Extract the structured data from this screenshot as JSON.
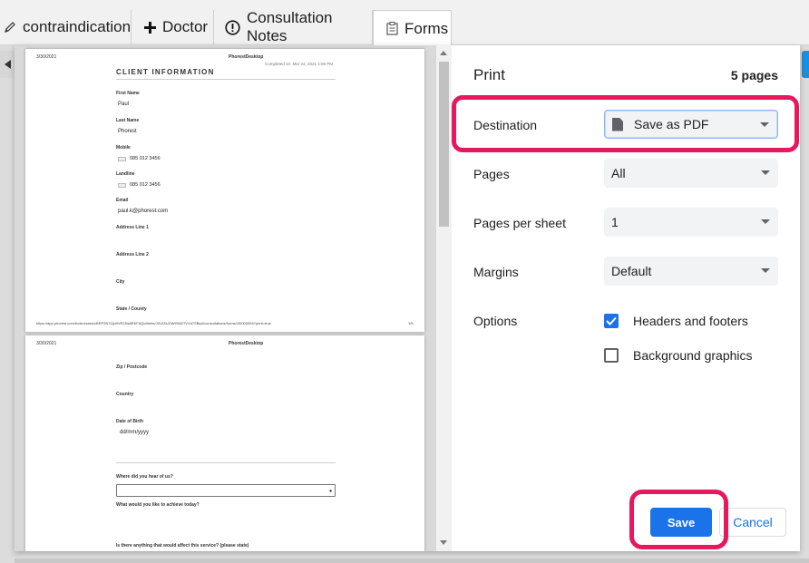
{
  "tabs": [
    {
      "label": "contraindication",
      "icon": "pencil-icon"
    },
    {
      "label": "Doctor",
      "icon": "plus-icon"
    },
    {
      "label": "Consultation Notes",
      "icon": "alert-circle-icon"
    },
    {
      "label": "Forms",
      "icon": "clipboard-icon",
      "active": true
    }
  ],
  "preview": {
    "page1": {
      "date": "3/30/2021",
      "app": "PhorestDesktop",
      "completed": "Completed on: Mar 24, 2021 4:06 PM",
      "title": "CLIENT INFORMATION",
      "fields": {
        "first_name_label": "First Name",
        "first_name_value": "Paul",
        "last_name_label": "Last Name",
        "last_name_value": "Phorest",
        "mobile_label": "Mobile",
        "mobile_value": "085 012 3456",
        "landline_label": "Landline",
        "landline_value": "085 012 3456",
        "email_label": "Email",
        "email_value": "paul.k@phorest.com",
        "address1_label": "Address Line 1",
        "address2_label": "Address Line 2",
        "city_label": "City",
        "state_label": "State / County"
      },
      "url": "https://app.phorest.com/businesses/vBRP3N7Qy0lVR2Ns8RKF6Q/clients/JSVIZkJ0WI0Nl2TVVd7SBsA/consultations/forms/1f0000054?print=true",
      "page_num": "1/5"
    },
    "page2": {
      "date": "3/30/2021",
      "app": "PhorestDesktop",
      "zip_label": "Zip / Postcode",
      "country_label": "Country",
      "dob_label": "Date of Birth",
      "dob_value": "dd/mm/yyyy",
      "hear_label": "Where did you hear of us?",
      "achieve_label": "What would you like to achieve today?",
      "affect_label": "Is there anything that would affect this service? (please state)"
    }
  },
  "print": {
    "title": "Print",
    "page_count": "5 pages",
    "destination_label": "Destination",
    "destination_value": "Save as PDF",
    "pages_label": "Pages",
    "pages_value": "All",
    "pps_label": "Pages per sheet",
    "pps_value": "1",
    "margins_label": "Margins",
    "margins_value": "Default",
    "options_label": "Options",
    "headers_footers_label": "Headers and footers",
    "headers_footers_checked": true,
    "background_graphics_label": "Background graphics",
    "background_graphics_checked": false,
    "save_label": "Save",
    "cancel_label": "Cancel"
  },
  "colors": {
    "accent": "#1a73e8",
    "highlight": "#e6195d"
  }
}
